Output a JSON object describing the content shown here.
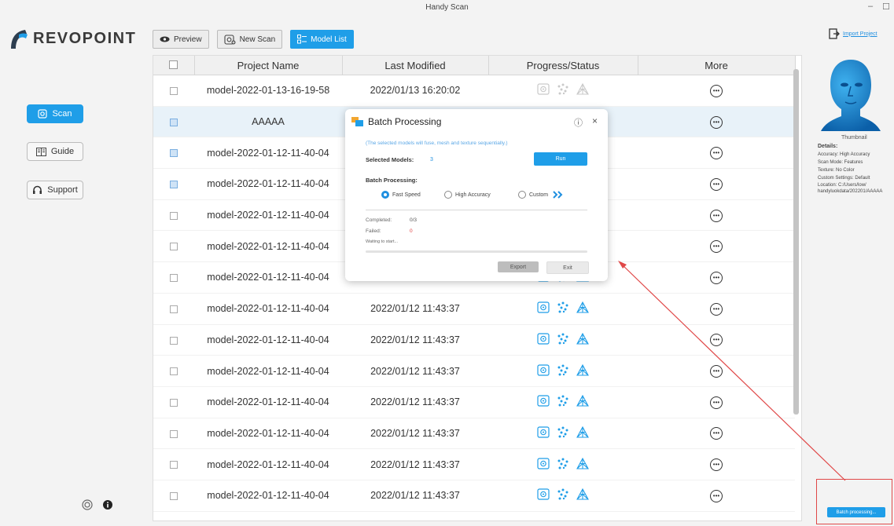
{
  "window": {
    "title": "Handy Scan",
    "minimize": "–",
    "maximize": "☐"
  },
  "brand": {
    "name": "REVOPOINT"
  },
  "nav": [
    {
      "label": "Scan",
      "icon": "scan-icon",
      "active": true
    },
    {
      "label": "Guide",
      "icon": "book-icon",
      "active": false
    },
    {
      "label": "Support",
      "icon": "headset-icon",
      "active": false
    }
  ],
  "toolbar": {
    "preview": "Preview",
    "new_scan": "New Scan",
    "model_list": "Model List"
  },
  "table": {
    "headers": [
      "",
      "Project Name",
      "Last Modified",
      "Progress/Status",
      "More"
    ],
    "rows": [
      {
        "name": "model-2022-01-13-16-19-58",
        "modified": "2022/01/13 16:20:02",
        "checked": false,
        "selected": false,
        "icons_active": false
      },
      {
        "name": "AAAAA",
        "modified": "",
        "checked": true,
        "selected": true,
        "icons_active": true
      },
      {
        "name": "model-2022-01-12-11-40-04",
        "modified": "",
        "checked": true,
        "selected": false,
        "icons_active": true
      },
      {
        "name": "model-2022-01-12-11-40-04",
        "modified": "",
        "checked": true,
        "selected": false,
        "icons_active": true
      },
      {
        "name": "model-2022-01-12-11-40-04",
        "modified": "",
        "checked": false,
        "selected": false,
        "icons_active": true
      },
      {
        "name": "model-2022-01-12-11-40-04",
        "modified": "",
        "checked": false,
        "selected": false,
        "icons_active": true
      },
      {
        "name": "model-2022-01-12-11-40-04",
        "modified": "",
        "checked": false,
        "selected": false,
        "icons_active": true
      },
      {
        "name": "model-2022-01-12-11-40-04",
        "modified": "2022/01/12 11:43:37",
        "checked": false,
        "selected": false,
        "icons_active": true
      },
      {
        "name": "model-2022-01-12-11-40-04",
        "modified": "2022/01/12 11:43:37",
        "checked": false,
        "selected": false,
        "icons_active": true
      },
      {
        "name": "model-2022-01-12-11-40-04",
        "modified": "2022/01/12 11:43:37",
        "checked": false,
        "selected": false,
        "icons_active": true
      },
      {
        "name": "model-2022-01-12-11-40-04",
        "modified": "2022/01/12 11:43:37",
        "checked": false,
        "selected": false,
        "icons_active": true
      },
      {
        "name": "model-2022-01-12-11-40-04",
        "modified": "2022/01/12 11:43:37",
        "checked": false,
        "selected": false,
        "icons_active": true
      },
      {
        "name": "model-2022-01-12-11-40-04",
        "modified": "2022/01/12 11:43:37",
        "checked": false,
        "selected": false,
        "icons_active": true
      },
      {
        "name": "model-2022-01-12-11-40-04",
        "modified": "2022/01/12 11:43:37",
        "checked": false,
        "selected": false,
        "icons_active": true
      }
    ]
  },
  "right_panel": {
    "import_label": "Import Project",
    "thumbnail_caption": "Thumbnail",
    "details_title": "Details:",
    "details": [
      "Accuracy: High Accuracy",
      "Scan Mode: Features",
      "Texture: No Color",
      "Custom Settings: Default",
      "Location:  C:/Users/low/",
      "handyluokdata/202201/AAAAA"
    ],
    "batch_button": "Batch processing..."
  },
  "dialog": {
    "title": "Batch Processing",
    "info_icon": "ⓘ",
    "close_icon": "×",
    "note": "(The selected models will fuse, mesh and texture sequentially.)",
    "selected_label": "Selected Models:",
    "selected_value": "3",
    "run": "Run",
    "batch_label": "Batch Processing:",
    "options": [
      "Fast Speed",
      "High Accuracy",
      "Custom"
    ],
    "selected_option": 0,
    "completed_label": "Completed:",
    "completed_value": "0/3",
    "failed_label": "Failed:",
    "failed_value": "0",
    "waiting": "Waiting to start...",
    "progress": 0,
    "export": "Export",
    "exit": "Exit"
  },
  "colors": {
    "accent": "#1f9ee8",
    "annotation": "#e04848",
    "selected_row": "#e8f2f9"
  }
}
